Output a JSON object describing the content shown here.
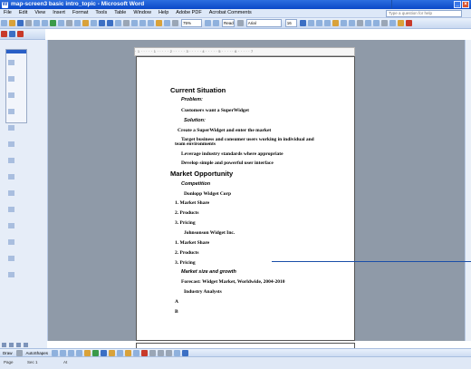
{
  "window": {
    "title": "map-screen3 basic intro_topic - Microsoft Word"
  },
  "menu": {
    "items": [
      "File",
      "Edit",
      "View",
      "Insert",
      "Format",
      "Tools",
      "Table",
      "Window",
      "Help",
      "Adobe PDF",
      "Acrobat Comments"
    ],
    "help_placeholder": "Type a question for help"
  },
  "toolbar": {
    "zoom": "75%",
    "font": "Arial",
    "font_size": "16",
    "read_label": "Read"
  },
  "drawing": {
    "autoshapes_label": "AutoShapes",
    "draw_label": "Draw"
  },
  "document": {
    "h1": "Current Situation",
    "problem_label": "Problem:",
    "problem_text": "Customers want a SuperWidget",
    "solution_label": "Solution:",
    "solution_1": "Create a SuperWidget and enter the market",
    "solution_2a": "Target business and consumer users working in individual and",
    "solution_2b": "team environments",
    "solution_3": "Leverage industry standards where appropriate",
    "solution_4": "Develop simple and powerful user interface",
    "h2": "Market Opportunity",
    "competition_label": "Competition",
    "comp1_name": "Donlopp Widget Corp",
    "comp1_items": [
      "1.  Market Share",
      "2.  Products",
      "3.  Pricing"
    ],
    "comp2_name": "Johnsonson Widget Inc.",
    "comp2_items": [
      "1.  Market Share",
      "2.  Products",
      "3.  Pricing"
    ],
    "market_size_label": "Market size and growth",
    "forecast": "Forecast: Widget Market, Worldwide, 2004-2010",
    "analysts": "Industry Analysts",
    "list_a": "A",
    "list_b": "B"
  },
  "status": {
    "page": "Page",
    "sec": "Sec 1",
    "at": "At"
  }
}
